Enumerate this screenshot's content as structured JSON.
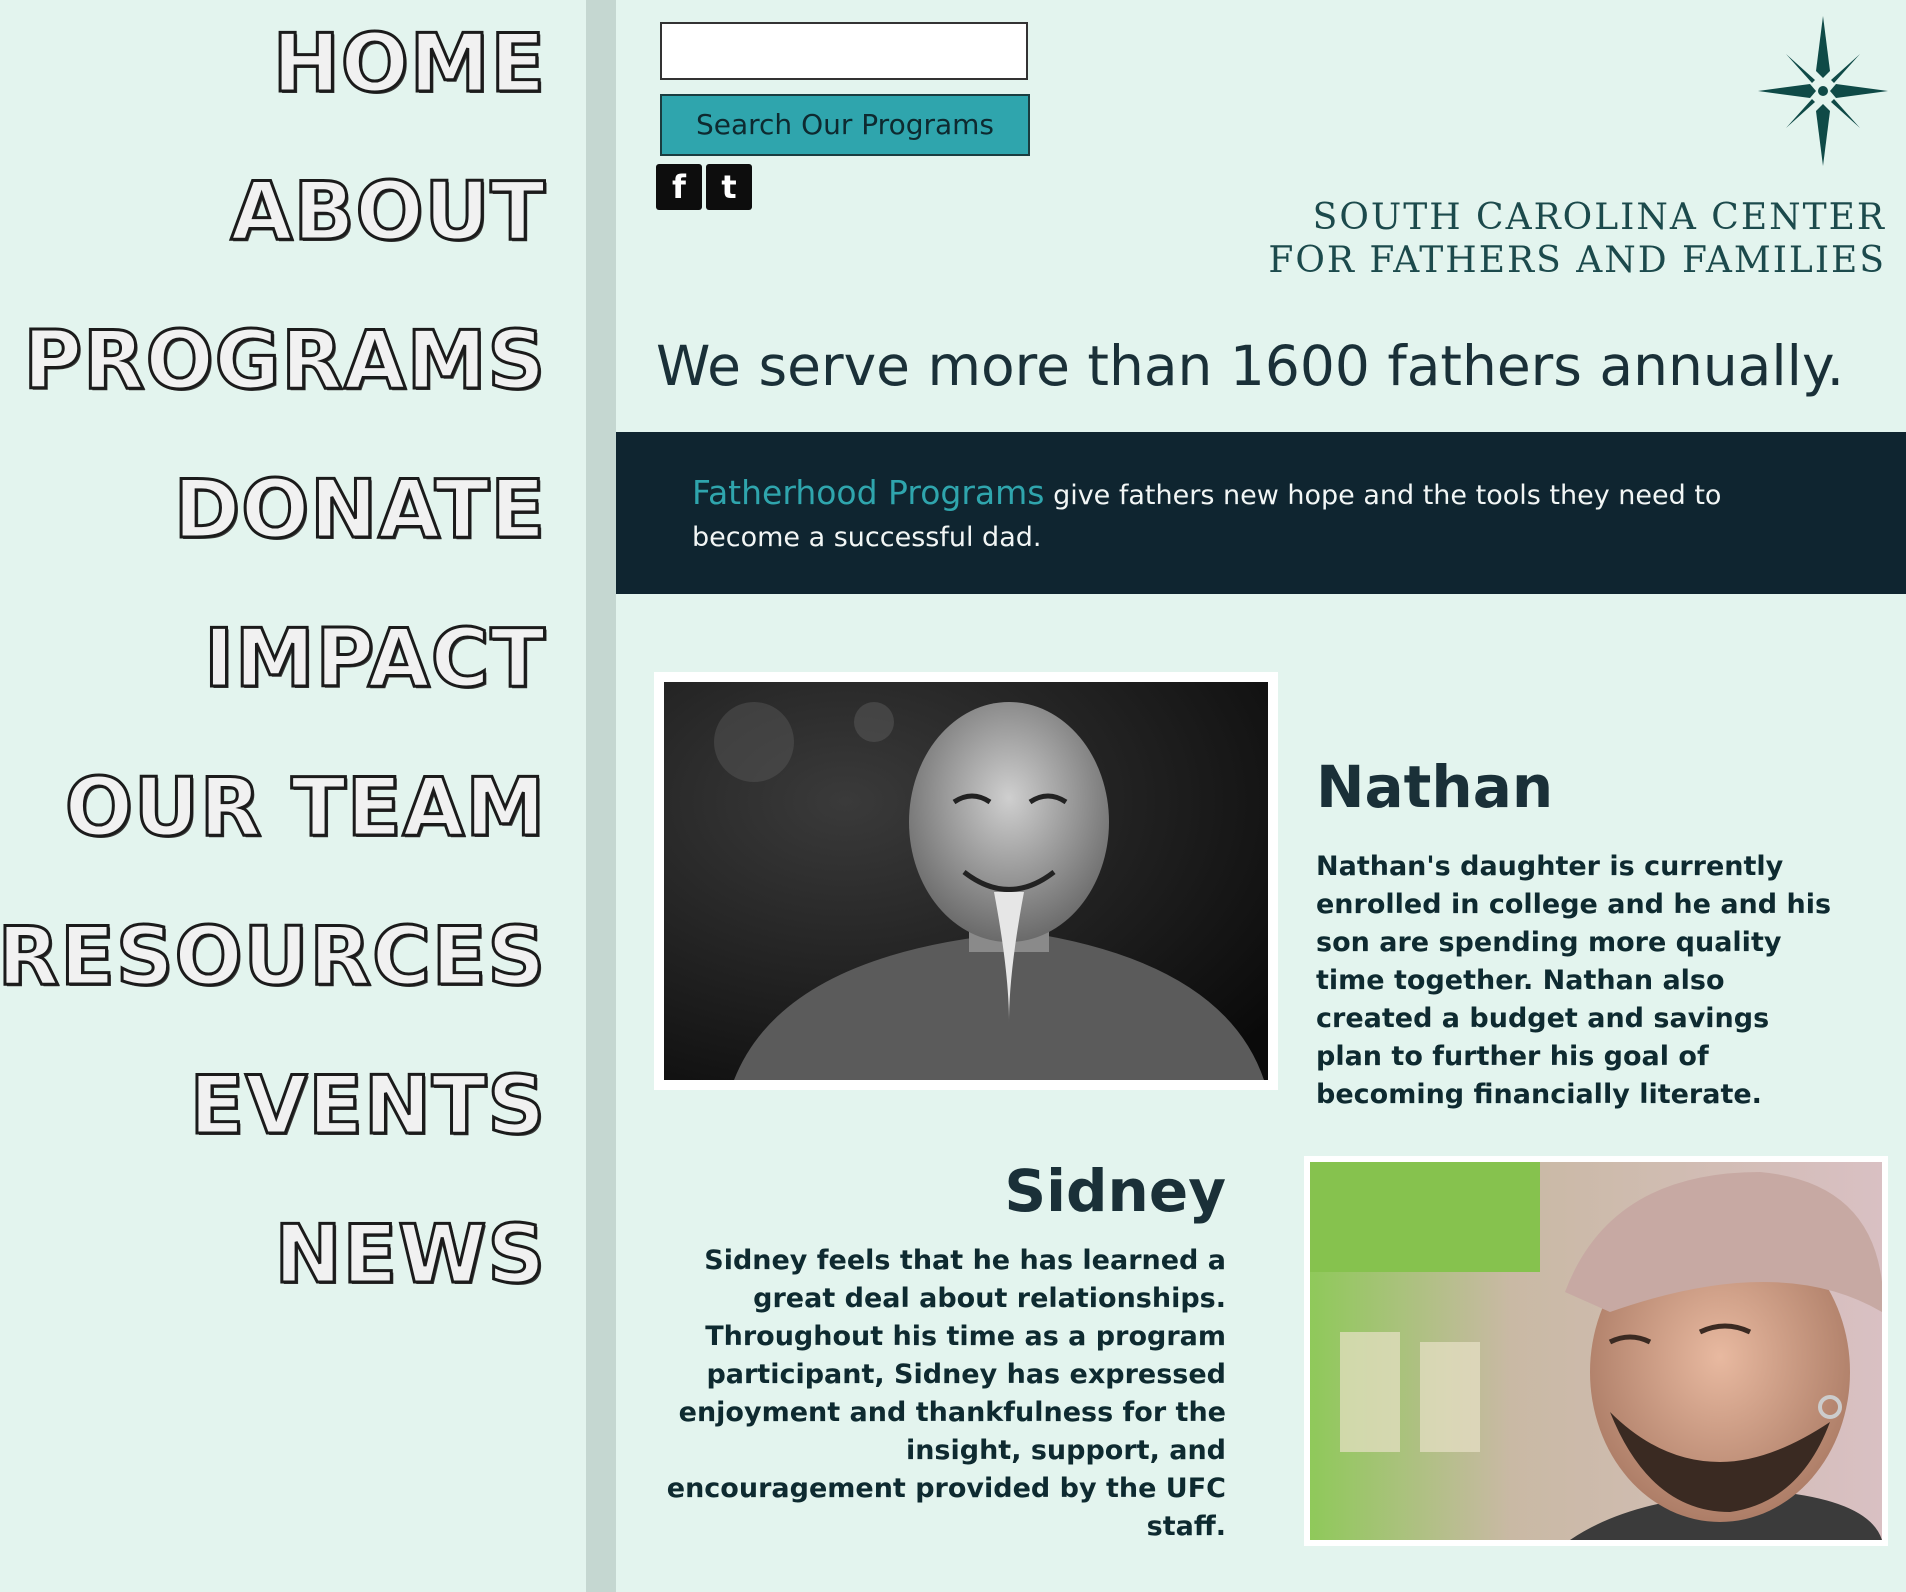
{
  "nav": {
    "items": [
      {
        "label": "HOME"
      },
      {
        "label": "ABOUT"
      },
      {
        "label": "PROGRAMS"
      },
      {
        "label": "DONATE"
      },
      {
        "label": "IMPACT"
      },
      {
        "label": "OUR TEAM"
      },
      {
        "label": "RESOURCES"
      },
      {
        "label": "EVENTS"
      },
      {
        "label": "NEWS"
      }
    ]
  },
  "search": {
    "value": "",
    "placeholder": "",
    "button_label": "Search Our Programs"
  },
  "social": {
    "facebook_glyph": "f",
    "twitter_glyph": "t"
  },
  "header": {
    "org_name_line1": "SOUTH CAROLINA CENTER",
    "org_name_line2": "FOR FATHERS AND FAMILIES",
    "tagline": "We serve more than 1600 fathers annually."
  },
  "banner": {
    "link_text": "Fatherhood Programs",
    "text": " give fathers new hope and the tools they need to become a successful dad."
  },
  "profiles": {
    "nathan": {
      "name": "Nathan",
      "bio": "Nathan's daughter is currently enrolled in college and he and his son are spending more quality time together. Nathan also created a budget and savings plan to further his goal of becoming financially literate."
    },
    "sidney": {
      "name": "Sidney",
      "bio": "Sidney feels that he has learned a great deal about relationships. Throughout his time as a program participant, Sidney has expressed enjoyment and thankfulness for the insight, support, and encouragement provided by the UFC staff."
    }
  },
  "colors": {
    "background": "#e3f4ee",
    "sidebar_divider": "#c5d7d1",
    "accent_teal": "#2fa5ad",
    "banner_dark": "#0f2530",
    "text_dark": "#0e2a30",
    "logo_green": "#0f4a47"
  },
  "icons": {
    "logo": "star-compass-icon",
    "facebook": "facebook-icon",
    "twitter": "twitter-icon"
  }
}
